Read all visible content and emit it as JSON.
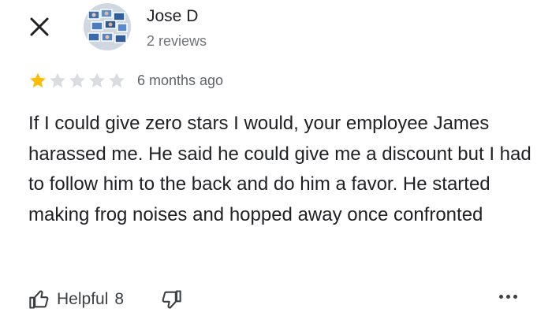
{
  "header": {
    "close_icon": "close-icon",
    "avatar_icon": "profile-photo"
  },
  "reviewer": {
    "name": "Jose D",
    "reviews": "2 reviews"
  },
  "rating": {
    "stars": 1,
    "max_stars": 5,
    "time_ago": "6 months ago",
    "filled_color": "#fbbc04",
    "empty_color": "#dadce0"
  },
  "review": {
    "text": "If I could give zero stars I would, your employee James harassed me. He said he could give me a discount but I had to follow him to the back and do him a favor. He started making frog noises and hopped away once confronted"
  },
  "actions": {
    "helpful_label": "Helpful",
    "helpful_count": "8",
    "like_icon": "thumbs-up-icon",
    "dislike_icon": "thumbs-down-icon",
    "more_icon": "more-options-icon"
  }
}
